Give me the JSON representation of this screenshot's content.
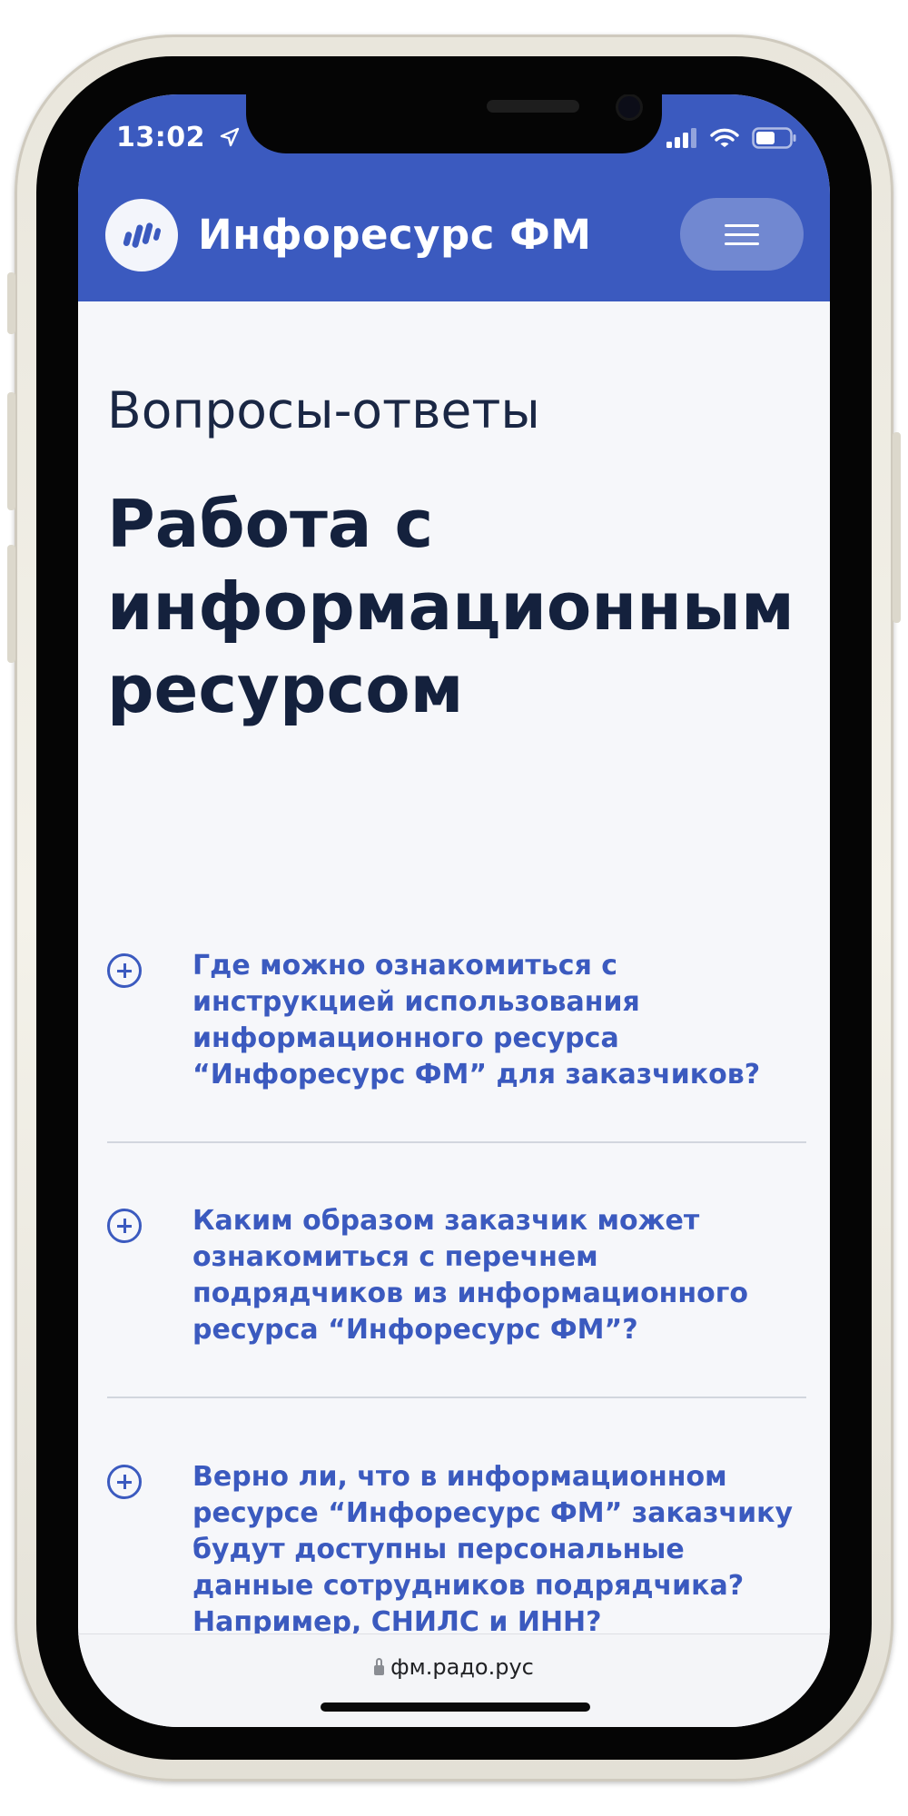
{
  "status_bar": {
    "time": "13:02"
  },
  "header": {
    "brand": "Инфоресурс ФМ",
    "accent_color": "#3b5abf"
  },
  "page": {
    "subtitle": "Вопросы-ответы",
    "title": "Работа с информационным ресурсом"
  },
  "faq": [
    {
      "question": "Где можно ознакомиться с инструкцией использования информационного ресурса “Инфоресурс ФМ” для заказчиков?"
    },
    {
      "question": "Каким образом заказчик может ознакомиться с перечнем подрядчиков из информационного ресурса “Инфоресурс ФМ”?"
    },
    {
      "question": "Верно ли, что в информационном ресурсе “Инфоресурс ФМ” заказчику будут доступны персональные данные сотрудников подрядчика? Например, СНИЛС и ИНН?"
    }
  ],
  "browser": {
    "url": "фм.радо.рус"
  },
  "icons": [
    "location-arrow-icon",
    "signal-icon",
    "wifi-icon",
    "battery-icon",
    "logo-bars-icon",
    "hamburger-menu-icon",
    "plus-circle-icon",
    "lock-icon"
  ]
}
